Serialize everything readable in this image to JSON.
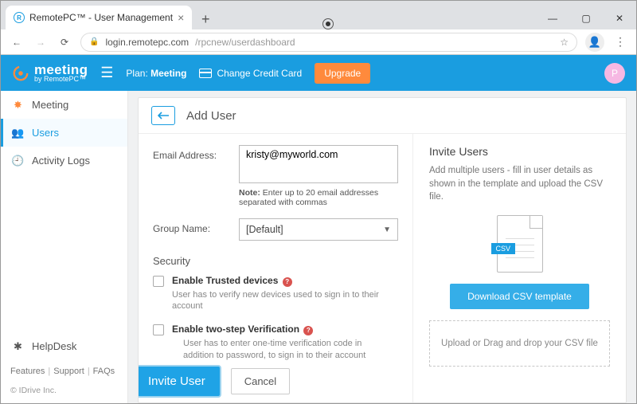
{
  "browser": {
    "tab_title": "RemotePC™ - User Management",
    "url_host": "login.remotepc.com",
    "url_path": "/rpcnew/userdashboard"
  },
  "appbar": {
    "brand_name": "meeting",
    "brand_sub": "by RemotePC™",
    "plan_label": "Plan: ",
    "plan_value": "Meeting",
    "change_cc": "Change Credit Card",
    "upgrade": "Upgrade",
    "avatar_initial": "P"
  },
  "sidebar": {
    "items": [
      {
        "label": "Meeting"
      },
      {
        "label": "Users"
      },
      {
        "label": "Activity Logs"
      }
    ],
    "helpdesk": "HelpDesk",
    "features": "Features",
    "support": "Support",
    "faqs": "FAQs",
    "copyright": "© IDrive Inc."
  },
  "card": {
    "title": "Add User",
    "email_label": "Email Address:",
    "email_value": "kristy@myworld.com",
    "note_prefix": "Note:",
    "note_text": " Enter up to 20 email addresses separated with commas",
    "group_label": "Group Name:",
    "group_value": "[Default]",
    "security_heading": "Security",
    "trusted_label": "Enable Trusted devices",
    "trusted_hint": "User has to verify new devices used to sign in to their account",
    "twostep_label": "Enable two-step Verification",
    "twostep_hint": "User has to enter one-time verification code in addition to password, to sign in to their account",
    "invite_btn": "Invite User",
    "cancel_btn": "Cancel"
  },
  "invite": {
    "heading": "Invite Users",
    "desc": "Add multiple users - fill in user details as shown in the template and upload the CSV file.",
    "csv_tag": "CSV",
    "download": "Download CSV template",
    "dropzone": "Upload or Drag and drop your CSV file"
  }
}
